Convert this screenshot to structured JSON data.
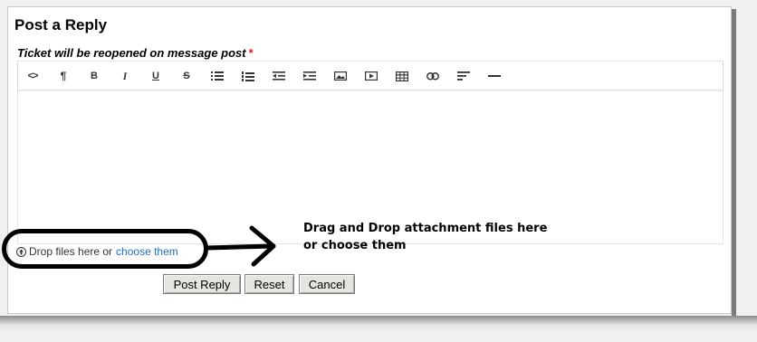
{
  "section": {
    "title": "Post a Reply",
    "reopen_note": "Ticket will be reopened on message post",
    "required_marker": "*"
  },
  "editor": {
    "toolbar": [
      {
        "name": "code-view",
        "icon": "code-icon",
        "glyph": "<>"
      },
      {
        "name": "paragraph",
        "icon": "paragraph-icon",
        "glyph": "¶"
      },
      {
        "name": "bold",
        "icon": "bold-icon",
        "glyph": "B"
      },
      {
        "name": "italic",
        "icon": "italic-icon",
        "glyph": "I"
      },
      {
        "name": "underline",
        "icon": "underline-icon",
        "glyph": "U"
      },
      {
        "name": "strikethrough",
        "icon": "strikethrough-icon",
        "glyph": "S"
      },
      {
        "name": "unordered-list",
        "icon": "bullet-list-icon"
      },
      {
        "name": "ordered-list",
        "icon": "numbered-list-icon"
      },
      {
        "name": "outdent",
        "icon": "outdent-icon"
      },
      {
        "name": "indent",
        "icon": "indent-icon"
      },
      {
        "name": "image",
        "icon": "image-icon"
      },
      {
        "name": "video",
        "icon": "video-icon"
      },
      {
        "name": "table",
        "icon": "table-icon"
      },
      {
        "name": "link",
        "icon": "link-icon"
      },
      {
        "name": "align",
        "icon": "align-left-icon"
      },
      {
        "name": "horizontal-rule",
        "icon": "horizontal-rule-icon"
      }
    ],
    "content": ""
  },
  "attachments": {
    "drop_text": "Drop files here or",
    "choose_link": "choose them",
    "icon": "upload-icon"
  },
  "annotation": {
    "line1": "Drag and Drop attachment files here",
    "line2": "or choose them"
  },
  "buttons": {
    "post_reply": "Post Reply",
    "reset": "Reset",
    "cancel": "Cancel"
  },
  "colors": {
    "link": "#1f6fb8",
    "required": "#e02020",
    "button_bg": "#e6e4df",
    "annotation": "#000000"
  }
}
